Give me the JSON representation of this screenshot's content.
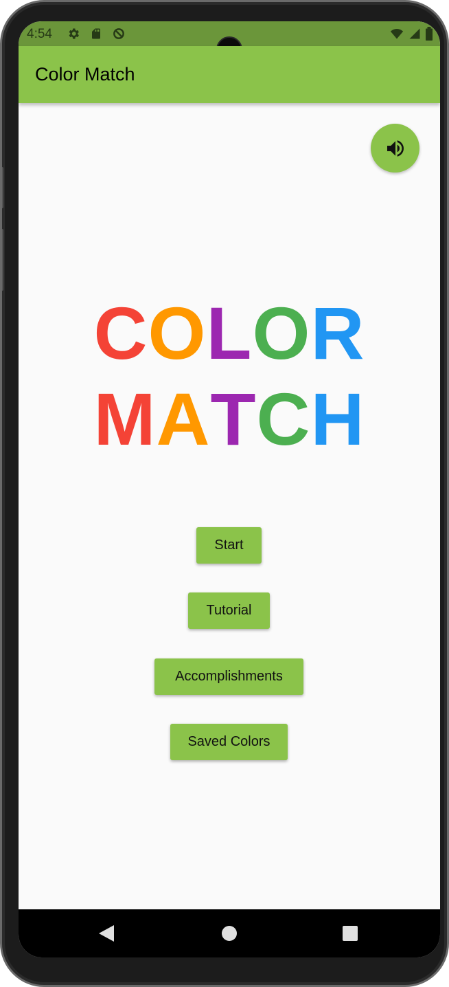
{
  "status_bar": {
    "time": "4:54",
    "left_icons": [
      "settings-icon",
      "sd-card-icon",
      "data-saver-icon"
    ],
    "right_icons": [
      "wifi-icon",
      "cellular-signal-icon",
      "battery-icon"
    ]
  },
  "app_bar": {
    "title": "Color Match"
  },
  "sound_button": {
    "icon": "volume-up-icon"
  },
  "logo": {
    "line1": [
      {
        "char": "C",
        "color": "#f44336"
      },
      {
        "char": "O",
        "color": "#ff9800"
      },
      {
        "char": "L",
        "color": "#9c27b0"
      },
      {
        "char": "O",
        "color": "#4caf50"
      },
      {
        "char": "R",
        "color": "#2196f3"
      }
    ],
    "line2": [
      {
        "char": "M",
        "color": "#f44336"
      },
      {
        "char": "A",
        "color": "#ff9800"
      },
      {
        "char": "T",
        "color": "#9c27b0"
      },
      {
        "char": "C",
        "color": "#4caf50"
      },
      {
        "char": "H",
        "color": "#2196f3"
      }
    ]
  },
  "menu": {
    "start": "Start",
    "tutorial": "Tutorial",
    "accomplishments": "Accomplishments",
    "saved_colors": "Saved Colors"
  },
  "nav_bar": {
    "icons": [
      "back-icon",
      "home-icon",
      "recents-icon"
    ]
  },
  "colors": {
    "accent": "#8bc34a",
    "status_bar": "#6b963a",
    "background": "#fafafa"
  }
}
